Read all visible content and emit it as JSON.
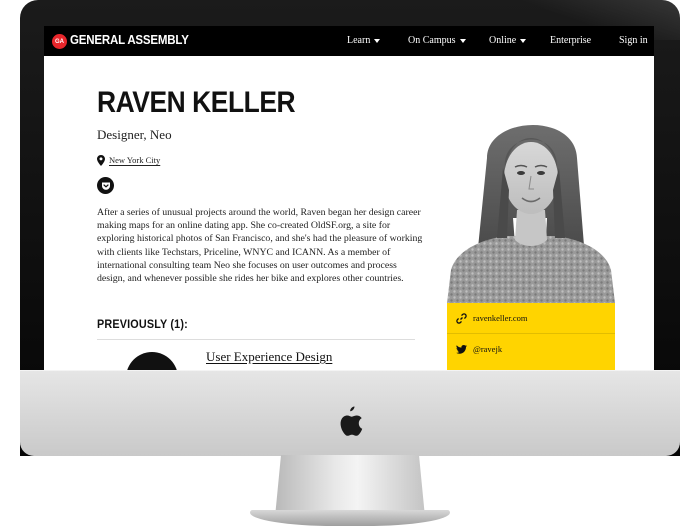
{
  "nav": {
    "logo_mark": "GA",
    "brand": "GENERAL ASSEMBLY",
    "items": [
      {
        "label": "Learn",
        "has_caret": true
      },
      {
        "label": "On Campus",
        "has_caret": true
      },
      {
        "label": "Online",
        "has_caret": true
      },
      {
        "label": "Enterprise",
        "has_caret": false
      },
      {
        "label": "Sign in",
        "has_caret": false
      }
    ]
  },
  "profile": {
    "name": "RAVEN KELLER",
    "title": "Designer, Neo",
    "location": "New York City",
    "bio": "After a series of unusual projects around the world, Raven began her design career making maps for an online dating app. She co-created OldSF.org, a site for exploring historical photos of San Francisco, and she's had the pleasure of working with clients like Techstars, Priceline, WNYC and ICANN. As a member of international consulting team Neo she focuses on user outcomes and process design, and whenever possible she rides her bike and explores other countries."
  },
  "previously": {
    "heading": "PREVIOUSLY (1):",
    "courses": [
      {
        "title": "User Experience Design"
      }
    ]
  },
  "links": [
    {
      "icon": "link-icon",
      "label": "ravenkeller.com"
    },
    {
      "icon": "twitter-icon",
      "label": "@ravejk"
    }
  ],
  "colors": {
    "accent_yellow": "#ffd400",
    "brand_red": "#e8262b",
    "nav_background": "#000000"
  }
}
